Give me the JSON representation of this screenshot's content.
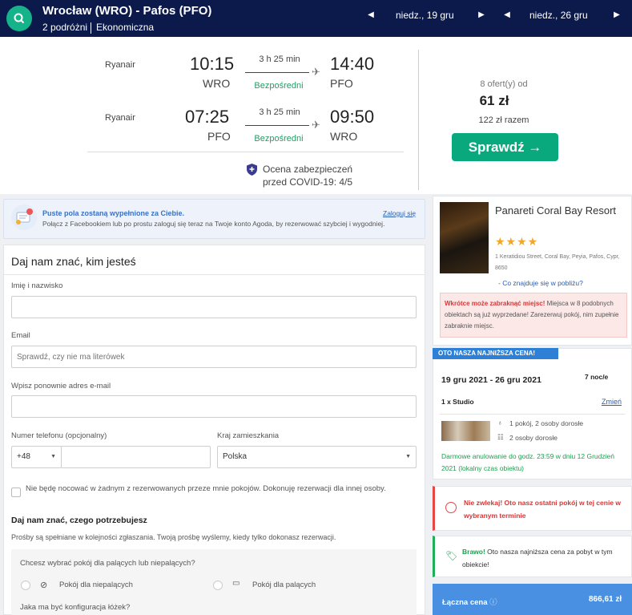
{
  "header": {
    "route": "Wrocław (WRO) - Pafos (PFO)",
    "travelers": "2 podróżni",
    "cabin": "Ekonomiczna",
    "depart_date": "niedz., 19 gru",
    "return_date": "niedz., 26 gru"
  },
  "flights": [
    {
      "airline": "Ryanair",
      "dep_time": "10:15",
      "dep_airport": "WRO",
      "duration": "3 h 25 min",
      "stops": "Bezpośredni",
      "arr_time": "14:40",
      "arr_airport": "PFO"
    },
    {
      "airline": "Ryanair",
      "dep_time": "07:25",
      "dep_airport": "PFO",
      "duration": "3 h 25 min",
      "stops": "Bezpośredni",
      "arr_time": "09:50",
      "arr_airport": "WRO"
    }
  ],
  "covid": {
    "line1": "Ocena zabezpieczeń",
    "line2": "przed COVID-19: 4/5"
  },
  "offer": {
    "count": "8 ofert(y) od",
    "price": "61 zł",
    "total": "122 zł razem",
    "check_label": "Sprawdź →"
  },
  "fb_banner": {
    "title": "Puste pola zostaną wypełnione za Ciebie.",
    "text": "Połącz z Facebookiem lub po prostu zaloguj się teraz na Twoje konto Agoda, by rezerwować szybciej i wygodniej.",
    "login": "Zaloguj się"
  },
  "form": {
    "title": "Daj nam znać, kim jesteś",
    "name_label": "Imię i nazwisko",
    "name_value": "",
    "email_label": "Email",
    "email_placeholder": "Sprawdź, czy nie ma literówek",
    "email_repeat_label": "Wpisz ponownie adres e-mail",
    "email_repeat_value": "",
    "phone_label": "Numer telefonu (opcjonalny)",
    "phone_code": "+48",
    "phone_value": "",
    "country_label": "Kraj zamieszkania",
    "country_value": "Polska",
    "checkbox_text": "Nie będę nocować w żadnym z rezerwowanych przeze mnie pokojów. Dokonuję rezerwacji dla innej osoby.",
    "needs_title": "Daj nam znać, czego potrzebujesz",
    "needs_sub": "Prośby są spełniane w kolejności zgłaszania. Twoją prośbę wyślemy, kiedy tylko dokonasz rezerwacji.",
    "smoking_question": "Chcesz wybrać pokój dla palących lub niepalących?",
    "nonsmoking": "Pokój dla niepalących",
    "smoking": "Pokój dla palących",
    "bed_question": "Jaka ma być konfiguracja łóżek?"
  },
  "hotel": {
    "name": "Panareti Coral Bay Resort",
    "stars": "★★★★",
    "address": "1 Keratidiou Street, Coral Bay, Peyia, Pafos, Cypr, 8650",
    "nearby": "- Co znajduje się w pobliżu?",
    "warn_bold": "Wkrótce może zabraknąć miejsc!",
    "warn_text": " Miejsca w 8 podobnych obiektach są już wyprzedane! Zarezerwuj pokój, nim zupełnie zabraknie miejsc."
  },
  "booking": {
    "badge": "OTO NASZA NAJNIŻSZA CENA!",
    "dates": "19 gru 2021 - 26 gru 2021",
    "nights": "7 noc/e",
    "room": "1 x Studio",
    "change": "Zmień",
    "room_info1": "1 pokój, 2 osoby dorosłe",
    "room_info2": "2 osoby dorosłe",
    "cancel": "Darmowe anulowanie do godz. 23:59 w dniu 12 Grudzień 2021 (lokalny czas obiektu)"
  },
  "alerts": {
    "red": "Nie zwlekaj! Oto nasz ostatni pokój w tej cenie w wybranym terminie",
    "green_bold": "Brawo!",
    "green_text": " Oto nasza najniższa cena za pobyt w tym obiekcie!"
  },
  "total": {
    "label": "Łączna cena",
    "info_icon": "ⓘ",
    "value": "866,61 zł"
  },
  "colors": {
    "header_bg": "#0b1a4b",
    "accent_green": "#0aa87d",
    "link_blue": "#2a5db0",
    "total_blue": "#4a90e2"
  }
}
